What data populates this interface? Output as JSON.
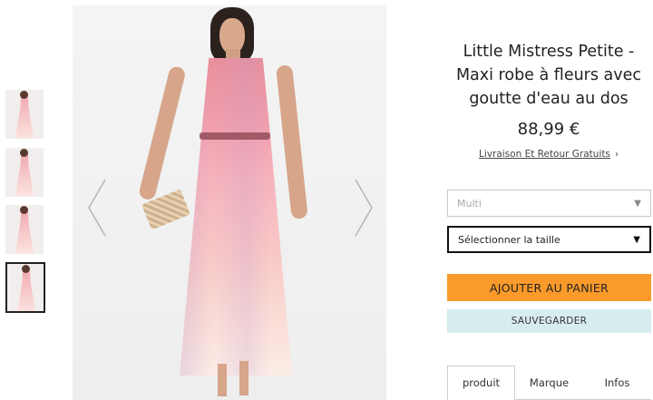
{
  "gallery": {
    "thumbnail_count": 4,
    "active_thumbnail": 4,
    "prev_icon": "chevron-left-icon",
    "next_icon": "chevron-right-icon"
  },
  "product": {
    "title": "Little Mistress Petite - Maxi robe à fleurs avec goutte d'eau au dos",
    "price": "88,99 €",
    "shipping_link": "Livraison Et Retour Gratuits",
    "shipping_chevron": "›"
  },
  "options": {
    "color_value": "Multi",
    "size_placeholder": "Sélectionner la taille",
    "caret": "▼"
  },
  "actions": {
    "add_to_cart": "AJOUTER AU PANIER",
    "save": "SAUVEGARDER"
  },
  "tabs": [
    {
      "label": "produit",
      "active": true
    },
    {
      "label": "Marque",
      "active": false
    },
    {
      "label": "Infos",
      "active": false
    }
  ],
  "colors": {
    "cart_button": "#f99a2a",
    "save_button": "#d7ecef"
  }
}
